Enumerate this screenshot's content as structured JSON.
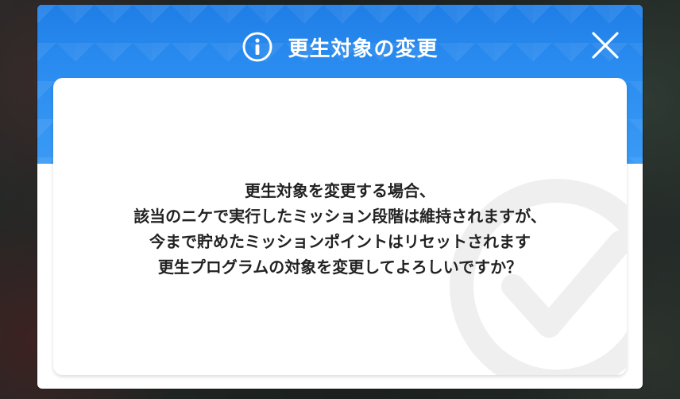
{
  "dialog": {
    "title": "更生対象の変更",
    "info_icon": "info-circle-icon",
    "close_icon": "close-x-icon",
    "message_lines": [
      "更生対象を変更する場合、",
      "該当のニケで実行したミッション段階は維持されますが、",
      "今まで貯めたミッションポイントはリセットされます",
      "更生プログラムの対象を変更してよろしいですか？"
    ],
    "watermark_icon": "check-circle-icon"
  },
  "colors": {
    "header_blue": "#2a8cf0",
    "text": "#222222",
    "panel": "#ffffff"
  }
}
